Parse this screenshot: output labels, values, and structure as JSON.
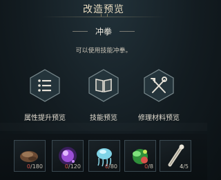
{
  "header": {
    "title": "改造预览"
  },
  "skill": {
    "name": "冲拳",
    "description": "可以使用技能冲拳。"
  },
  "options": [
    {
      "label": "属性提升预览",
      "icon": "list-icon"
    },
    {
      "label": "技能预览",
      "icon": "book-icon"
    },
    {
      "label": "修理材料预览",
      "icon": "crossed-tools-icon"
    }
  ],
  "materials": [
    {
      "icon": "rock-ore-icon",
      "have": "0",
      "sep": "/",
      "need": "180"
    },
    {
      "icon": "purple-crystal-icon",
      "have": "0",
      "sep": "/",
      "need": "120"
    },
    {
      "icon": "jellyfish-icon",
      "have": "0",
      "sep": "/",
      "need": "80"
    },
    {
      "icon": "green-leaf-orb-icon",
      "have": "0",
      "sep": "/",
      "need": "8"
    },
    {
      "icon": "bone-stick-icon",
      "have": "4",
      "sep": "/",
      "need": "5"
    }
  ],
  "colors": {
    "insufficient": "#d9534a",
    "accent": "#e9dcc0",
    "background": "#131c21"
  }
}
